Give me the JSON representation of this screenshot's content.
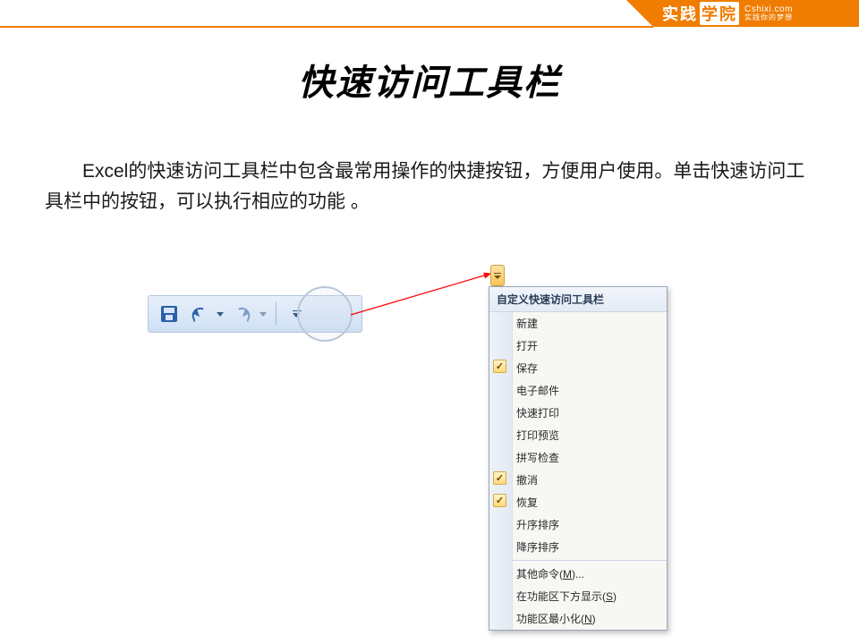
{
  "banner": {
    "brand_1": "实践",
    "brand_2": "学院",
    "url": "Cshixi.com",
    "tagline": "实践你的梦想"
  },
  "heading": "快速访问工具栏",
  "body_text": "Excel的快速访问工具栏中包含最常用操作的快捷按钮，方便用户使用。单击快速访问工具栏中的按钮，可以执行相应的功能 。",
  "qat_buttons": {
    "save": "保存",
    "undo": "撤消",
    "redo": "恢复",
    "customize": "自定义快速访问工具栏"
  },
  "dropdown": {
    "title": "自定义快速访问工具栏",
    "items": [
      {
        "label": "新建",
        "checked": false
      },
      {
        "label": "打开",
        "checked": false
      },
      {
        "label": "保存",
        "checked": true
      },
      {
        "label": "电子邮件",
        "checked": false
      },
      {
        "label": "快速打印",
        "checked": false
      },
      {
        "label": "打印预览",
        "checked": false
      },
      {
        "label": "拼写检查",
        "checked": false
      },
      {
        "label": "撤消",
        "checked": true
      },
      {
        "label": "恢复",
        "checked": true
      },
      {
        "label": "升序排序",
        "checked": false
      },
      {
        "label": "降序排序",
        "checked": false
      }
    ],
    "footer": [
      {
        "prefix": "其他命令(",
        "mnemonic": "M",
        "suffix": ")..."
      },
      {
        "prefix": "在功能区下方显示(",
        "mnemonic": "S",
        "suffix": ")"
      },
      {
        "prefix": "功能区最小化(",
        "mnemonic": "N",
        "suffix": ")"
      }
    ]
  },
  "colors": {
    "accent": "#f07c00",
    "arrow": "#ff0000"
  }
}
